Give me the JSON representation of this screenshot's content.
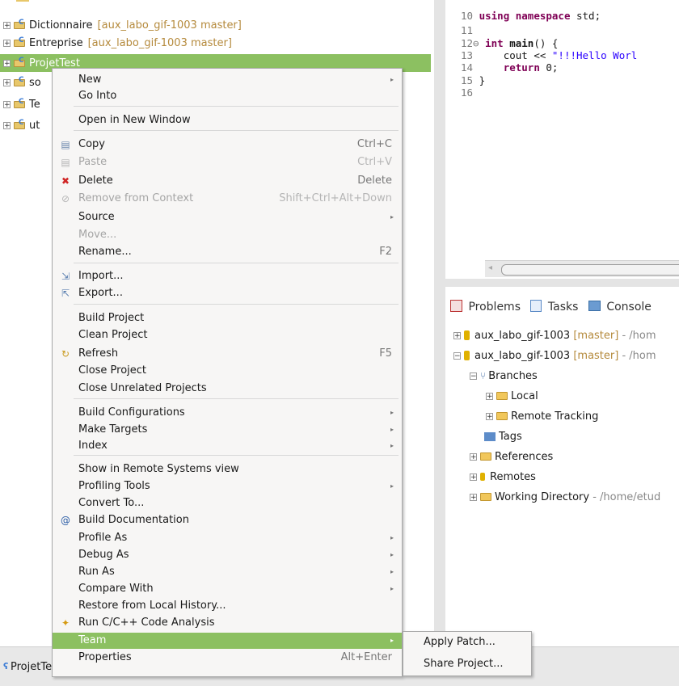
{
  "explorer": {
    "rows": [
      {
        "name": "Dictionnaire",
        "deco": "[aux_labo_gif-1003 master]"
      },
      {
        "name": "Entreprise",
        "deco": "[aux_labo_gif-1003 master]"
      },
      {
        "name": "ProjetTest",
        "deco": ""
      },
      {
        "name": "so",
        "deco": ""
      },
      {
        "name": "Te",
        "deco": ""
      },
      {
        "name": "ut",
        "deco": ""
      }
    ]
  },
  "editor": {
    "lines": [
      {
        "num": "10",
        "parts": [
          {
            "t": "using namespace",
            "k": "kw"
          },
          {
            "t": " std;",
            "k": ""
          }
        ]
      },
      {
        "num": "11",
        "parts": []
      },
      {
        "num": "12⊖",
        "parts": [
          {
            "t": "int",
            "k": "kw"
          },
          {
            "t": " ",
            "k": ""
          },
          {
            "t": "main",
            "k": "kwb"
          },
          {
            "t": "() {",
            "k": ""
          }
        ]
      },
      {
        "num": "13",
        "parts": [
          {
            "t": "    cout << ",
            "k": ""
          },
          {
            "t": "\"!!!Hello Worl",
            "k": "str"
          }
        ]
      },
      {
        "num": "14",
        "parts": [
          {
            "t": "    ",
            "k": ""
          },
          {
            "t": "return",
            "k": "kw"
          },
          {
            "t": " 0;",
            "k": ""
          }
        ]
      },
      {
        "num": "15",
        "parts": [
          {
            "t": "}",
            "k": ""
          }
        ]
      },
      {
        "num": "16",
        "parts": []
      }
    ]
  },
  "panel": {
    "tabs": [
      "Problems",
      "Tasks",
      "Console"
    ],
    "git": {
      "repo1": "aux_labo_gif-1003",
      "repo1_branch": "[master]",
      "repo1_path": "- /hom",
      "repo2": "aux_labo_gif-1003",
      "repo2_branch": "[master]",
      "repo2_path": "- /hom",
      "branches": "Branches",
      "local": "Local",
      "remote_tracking": "Remote Tracking",
      "tags": "Tags",
      "references": "References",
      "remotes": "Remotes",
      "working_dir": "Working Directory",
      "working_dir_path": "- /home/etud"
    }
  },
  "menu": {
    "items": [
      {
        "label": "New",
        "accel": "",
        "arrow": true
      },
      {
        "label": "Go Into",
        "accel": ""
      },
      {
        "label": "Open in New Window",
        "accel": ""
      },
      {
        "label": "Copy",
        "accel": "Ctrl+C",
        "icon": "copy-icon"
      },
      {
        "label": "Paste",
        "accel": "Ctrl+V",
        "icon": "paste-icon",
        "disabled": true
      },
      {
        "label": "Delete",
        "accel": "Delete",
        "icon": "delete-icon"
      },
      {
        "label": "Remove from Context",
        "accel": "Shift+Ctrl+Alt+Down",
        "icon": "remove-context-icon",
        "disabled": true
      },
      {
        "label": "Source",
        "arrow": true
      },
      {
        "label": "Move...",
        "disabled": true
      },
      {
        "label": "Rename...",
        "accel": "F2"
      },
      {
        "label": "Import...",
        "icon": "import-icon"
      },
      {
        "label": "Export...",
        "icon": "export-icon"
      },
      {
        "label": "Build Project"
      },
      {
        "label": "Clean Project"
      },
      {
        "label": "Refresh",
        "accel": "F5",
        "icon": "refresh-icon"
      },
      {
        "label": "Close Project"
      },
      {
        "label": "Close Unrelated Projects"
      },
      {
        "label": "Build Configurations",
        "arrow": true
      },
      {
        "label": "Make Targets",
        "arrow": true
      },
      {
        "label": "Index",
        "arrow": true
      },
      {
        "label": "Show in Remote Systems view"
      },
      {
        "label": "Profiling Tools",
        "arrow": true
      },
      {
        "label": "Convert To..."
      },
      {
        "label": "Build Documentation",
        "icon": "at-icon"
      },
      {
        "label": "Profile As",
        "arrow": true
      },
      {
        "label": "Debug As",
        "arrow": true
      },
      {
        "label": "Run As",
        "arrow": true
      },
      {
        "label": "Compare With",
        "arrow": true
      },
      {
        "label": "Restore from Local History..."
      },
      {
        "label": "Run C/C++ Code Analysis",
        "icon": "code-analysis-icon"
      },
      {
        "label": "Team",
        "arrow": true,
        "highlight": true
      },
      {
        "label": "Properties",
        "accel": "Alt+Enter"
      }
    ]
  },
  "submenu": {
    "items": [
      "Apply Patch...",
      "Share Project..."
    ]
  },
  "statusbar": {
    "label": "ProjetTest"
  },
  "colors": {
    "selection": "#8cc061",
    "keyword": "#7f0055",
    "string": "#2a00ff"
  }
}
